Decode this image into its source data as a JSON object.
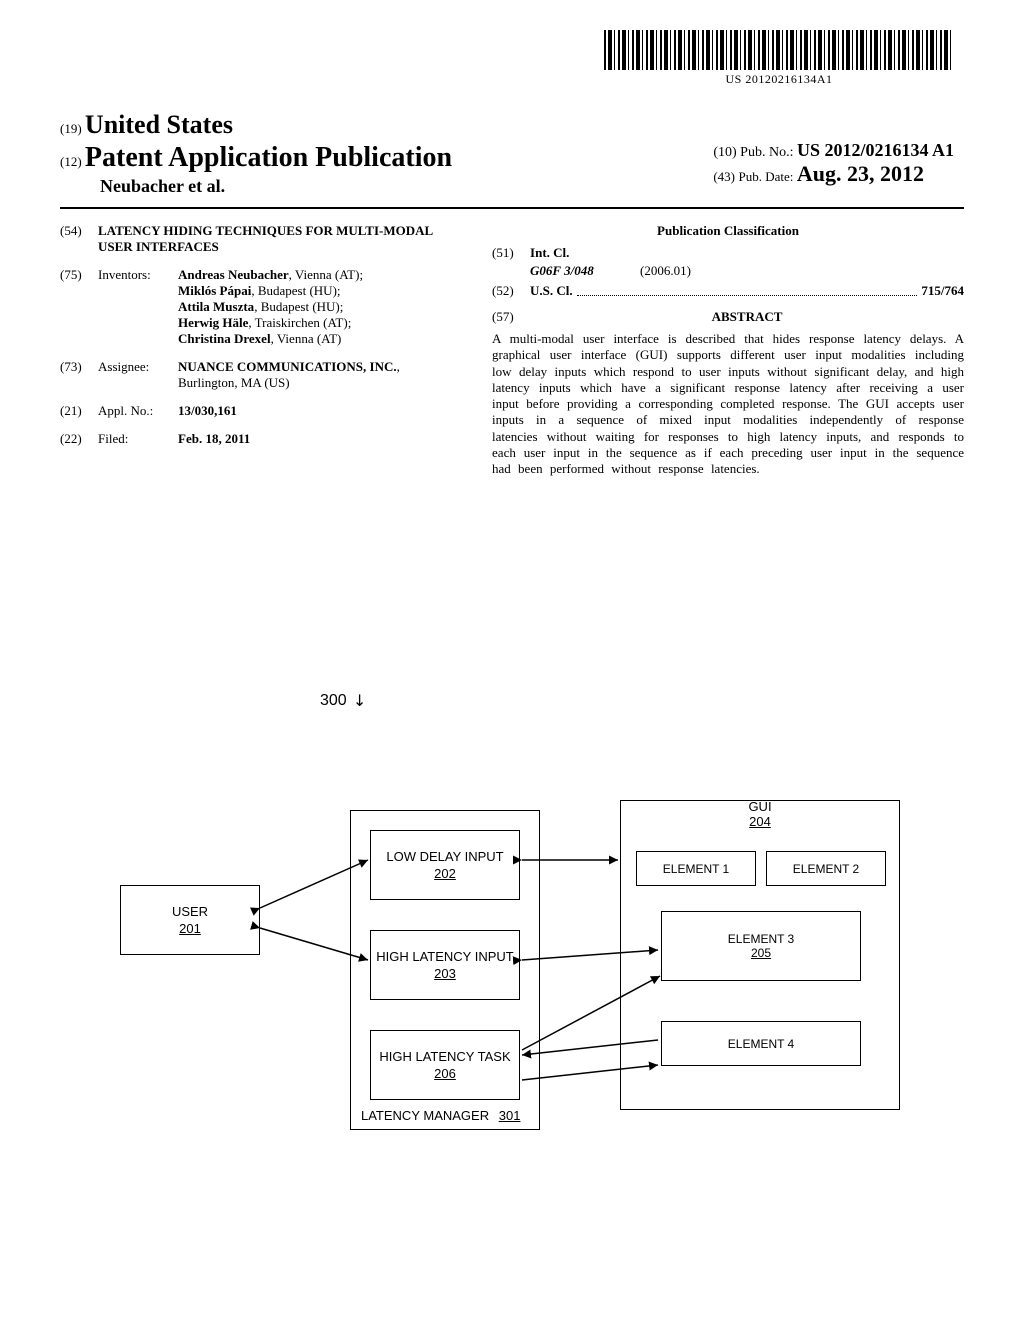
{
  "barcode_text": "US 20120216134A1",
  "country_code": "(19)",
  "country": "United States",
  "pub_code": "(12)",
  "pub_title": "Patent Application Publication",
  "pub_name": "Neubacher et al.",
  "pubno_code": "(10)",
  "pubno_label": "Pub. No.:",
  "pubno_value": "US 2012/0216134 A1",
  "pubdate_code": "(43)",
  "pubdate_label": "Pub. Date:",
  "pubdate_value": "Aug. 23, 2012",
  "field54": {
    "code": "(54)",
    "title": "LATENCY HIDING TECHNIQUES FOR MULTI-MODAL USER INTERFACES"
  },
  "field75": {
    "code": "(75)",
    "label": "Inventors:",
    "inventors": [
      {
        "name": "Andreas Neubacher",
        "loc": ", Vienna (AT);"
      },
      {
        "name": "Miklós Pápai",
        "loc": ", Budapest (HU);"
      },
      {
        "name": "Attila Muszta",
        "loc": ", Budapest (HU);"
      },
      {
        "name": "Herwig Häle",
        "loc": ", Traiskirchen (AT);"
      },
      {
        "name": "Christina Drexel",
        "loc": ", Vienna (AT)"
      }
    ]
  },
  "field73": {
    "code": "(73)",
    "label": "Assignee:",
    "name": "NUANCE COMMUNICATIONS, INC.",
    "loc": ", Burlington, MA (US)"
  },
  "field21": {
    "code": "(21)",
    "label": "Appl. No.:",
    "value": "13/030,161"
  },
  "field22": {
    "code": "(22)",
    "label": "Filed:",
    "value": "Feb. 18, 2011"
  },
  "classification": {
    "title": "Publication Classification",
    "intcl_code": "(51)",
    "intcl_label": "Int. Cl.",
    "intcl_class": "G06F 3/048",
    "intcl_date": "(2006.01)",
    "uscl_code": "(52)",
    "uscl_label": "U.S. Cl.",
    "uscl_value": "715/764"
  },
  "abstract": {
    "code": "(57)",
    "title": "ABSTRACT",
    "text": "A multi-modal user interface is described that hides response latency delays. A graphical user interface (GUI) supports different user input modalities including low delay inputs which respond to user inputs without significant delay, and high latency inputs which have a significant response latency after receiving a user input before providing a corresponding completed response. The GUI accepts user inputs in a sequence of mixed input modalities independently of response latencies without waiting for responses to high latency inputs, and responds to each user input in the sequence as if each preceding user input in the sequence had been performed without response latencies."
  },
  "figure": {
    "ref": "300",
    "user": {
      "label": "USER",
      "num": "201"
    },
    "low_delay": {
      "label": "LOW DELAY INPUT",
      "num": "202"
    },
    "high_latency_input": {
      "label": "HIGH LATENCY INPUT",
      "num": "203"
    },
    "high_latency_task": {
      "label": "HIGH LATENCY TASK",
      "num": "206"
    },
    "latency_manager": {
      "label": "LATENCY MANAGER",
      "num": "301"
    },
    "gui": {
      "label": "GUI",
      "num": "204"
    },
    "elem1": "ELEMENT 1",
    "elem2": "ELEMENT 2",
    "elem3": {
      "label": "ELEMENT 3",
      "num": "205"
    },
    "elem4": "ELEMENT 4"
  }
}
